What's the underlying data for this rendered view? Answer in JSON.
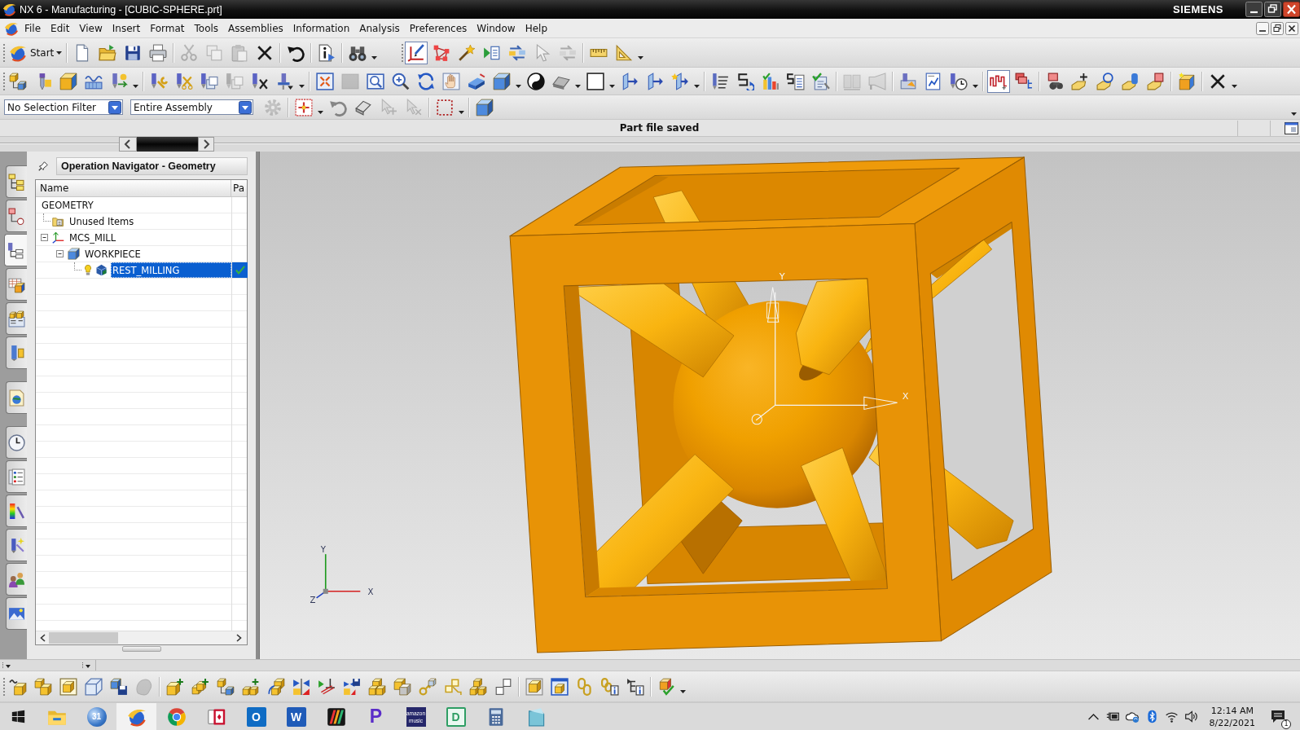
{
  "window": {
    "title": "NX 6 - Manufacturing - [CUBIC-SPHERE.prt]",
    "brand": "SIEMENS"
  },
  "menu": [
    {
      "label": "File"
    },
    {
      "label": "Edit"
    },
    {
      "label": "View"
    },
    {
      "label": "Insert"
    },
    {
      "label": "Format"
    },
    {
      "label": "Tools"
    },
    {
      "label": "Assemblies"
    },
    {
      "label": "Information"
    },
    {
      "label": "Analysis"
    },
    {
      "label": "Preferences"
    },
    {
      "label": "Window"
    },
    {
      "label": "Help"
    }
  ],
  "standard_toolbar": {
    "start_label": "Start",
    "buttons": [
      {
        "disabled": false,
        "on": false
      },
      {
        "disabled": false,
        "on": false
      },
      {
        "disabled": false,
        "on": false
      },
      {
        "disabled": false,
        "on": false
      },
      {
        "disabled": true,
        "on": false
      },
      {
        "disabled": true,
        "on": false
      },
      {
        "disabled": true,
        "on": false
      },
      {
        "disabled": false,
        "on": false
      },
      {
        "disabled": false,
        "on": false
      },
      {
        "disabled": false,
        "on": false
      },
      {
        "disabled": false,
        "on": false
      },
      {
        "disabled": false,
        "on": true
      },
      {
        "disabled": false,
        "on": false
      },
      {
        "disabled": false,
        "on": false
      },
      {
        "disabled": false,
        "on": false
      },
      {
        "disabled": false,
        "on": false
      },
      {
        "disabled": true,
        "on": false
      },
      {
        "disabled": true,
        "on": false
      },
      {
        "disabled": false,
        "on": false
      },
      {
        "disabled": false,
        "on": false
      }
    ]
  },
  "toolbar_row_2": {
    "buttons": [
      {
        "disabled": false,
        "on": false
      },
      {
        "disabled": false,
        "on": false
      },
      {
        "disabled": false,
        "on": false
      },
      {
        "disabled": false,
        "on": false
      },
      {
        "disabled": false,
        "on": false
      },
      {
        "disabled": false,
        "on": false
      },
      {
        "disabled": false,
        "on": false
      },
      {
        "disabled": false,
        "on": false
      },
      {
        "disabled": true,
        "on": false
      },
      {
        "disabled": false,
        "on": false
      },
      {
        "disabled": false,
        "on": false
      },
      {
        "disabled": false,
        "on": false
      },
      {
        "disabled": true,
        "on": false
      },
      {
        "disabled": false,
        "on": false
      },
      {
        "disabled": false,
        "on": false
      },
      {
        "disabled": false,
        "on": false
      },
      {
        "disabled": false,
        "on": false
      },
      {
        "disabled": false,
        "on": false
      },
      {
        "disabled": false,
        "on": false
      },
      {
        "disabled": false,
        "on": false
      },
      {
        "disabled": false,
        "on": false
      },
      {
        "disabled": false,
        "on": false
      },
      {
        "disabled": false,
        "on": false
      },
      {
        "disabled": false,
        "on": false
      },
      {
        "disabled": false,
        "on": false
      },
      {
        "disabled": false,
        "on": false
      },
      {
        "disabled": false,
        "on": false
      },
      {
        "disabled": false,
        "on": false
      },
      {
        "disabled": false,
        "on": false
      },
      {
        "disabled": false,
        "on": false
      },
      {
        "disabled": true,
        "on": false
      },
      {
        "disabled": true,
        "on": false
      },
      {
        "disabled": false,
        "on": false
      },
      {
        "disabled": false,
        "on": false
      },
      {
        "disabled": false,
        "on": false
      },
      {
        "disabled": false,
        "on": true
      },
      {
        "disabled": false,
        "on": false
      },
      {
        "disabled": false,
        "on": false
      },
      {
        "disabled": false,
        "on": false
      },
      {
        "disabled": false,
        "on": false
      },
      {
        "disabled": false,
        "on": false
      },
      {
        "disabled": false,
        "on": false
      },
      {
        "disabled": false,
        "on": false
      },
      {
        "disabled": false,
        "on": false
      }
    ]
  },
  "selection_bar": {
    "filter": "No Selection Filter",
    "scope": "Entire Assembly",
    "buttons": [
      {
        "disabled": true,
        "on": false
      },
      {
        "disabled": false,
        "on": false
      },
      {
        "disabled": true,
        "on": false
      },
      {
        "disabled": false,
        "on": false
      },
      {
        "disabled": true,
        "on": false
      },
      {
        "disabled": true,
        "on": false
      },
      {
        "disabled": false,
        "on": false
      },
      {
        "disabled": false,
        "on": false
      }
    ]
  },
  "status_bar": {
    "message": "Part file saved"
  },
  "resource_bar": {
    "groups": [
      {
        "tabs": [
          {
            "selected": false
          },
          {
            "selected": false
          },
          {
            "selected": true
          },
          {
            "selected": false
          },
          {
            "selected": false
          },
          {
            "selected": false
          }
        ]
      },
      {
        "tabs": [
          {
            "selected": false
          }
        ]
      },
      {
        "tabs": [
          {
            "selected": false
          },
          {
            "selected": false
          },
          {
            "selected": false
          },
          {
            "selected": false
          },
          {
            "selected": false
          },
          {
            "selected": false
          }
        ]
      }
    ]
  },
  "navigator": {
    "title": "Operation Navigator - Geometry",
    "columns": [
      "Name",
      "Pa"
    ],
    "tree": [
      {
        "name": "GEOMETRY",
        "kind": "root",
        "selected": false,
        "pa_tick": false,
        "children": [
          {
            "name": "Unused Items",
            "kind": "group",
            "selected": false,
            "pa_tick": false
          },
          {
            "name": "MCS_MILL",
            "kind": "mcs",
            "expanded": true,
            "selected": false,
            "pa_tick": false,
            "children": [
              {
                "name": "WORKPIECE",
                "kind": "workpiece",
                "expanded": true,
                "selected": false,
                "pa_tick": false,
                "children": [
                  {
                    "name": "REST_MILLING",
                    "kind": "operation",
                    "selected": true,
                    "pa_tick": true
                  }
                ]
              }
            ]
          }
        ]
      }
    ]
  },
  "graphics": {
    "wcs_axes": {
      "x_label": "X",
      "y_label": "Y",
      "z_label": "Z"
    },
    "mcs_axes": {
      "x_label": "X",
      "y_label": "Y"
    }
  },
  "bottom_toolbar": {
    "buttons": [
      {
        "disabled": false,
        "on": false
      },
      {
        "disabled": false,
        "on": false
      },
      {
        "disabled": false,
        "on": false
      },
      {
        "disabled": false,
        "on": false
      },
      {
        "disabled": false,
        "on": false
      },
      {
        "disabled": true,
        "on": false
      },
      {
        "disabled": false,
        "on": false
      },
      {
        "disabled": false,
        "on": false
      },
      {
        "disabled": false,
        "on": false
      },
      {
        "disabled": false,
        "on": false
      },
      {
        "disabled": false,
        "on": false
      },
      {
        "disabled": false,
        "on": false
      },
      {
        "disabled": false,
        "on": false
      },
      {
        "disabled": false,
        "on": false
      },
      {
        "disabled": false,
        "on": false
      },
      {
        "disabled": false,
        "on": false
      },
      {
        "disabled": false,
        "on": false
      },
      {
        "disabled": false,
        "on": false
      },
      {
        "disabled": false,
        "on": false
      },
      {
        "disabled": false,
        "on": false
      },
      {
        "disabled": false,
        "on": false
      },
      {
        "disabled": false,
        "on": false
      },
      {
        "disabled": false,
        "on": false
      },
      {
        "disabled": false,
        "on": false
      },
      {
        "disabled": false,
        "on": false
      },
      {
        "disabled": false,
        "on": false
      }
    ]
  },
  "taskbar": {
    "apps": [
      {
        "selected": false
      },
      {
        "selected": false,
        "glyph": "31"
      },
      {
        "selected": true
      },
      {
        "selected": false
      },
      {
        "selected": false
      },
      {
        "selected": false,
        "glyph": "O"
      },
      {
        "selected": false,
        "glyph": "W"
      },
      {
        "selected": false
      },
      {
        "selected": false,
        "glyph": "P"
      },
      {
        "selected": false,
        "glyph": "amazon music"
      },
      {
        "selected": false,
        "glyph": "D"
      },
      {
        "selected": false
      },
      {
        "selected": false
      }
    ],
    "clock": {
      "time": "12:14 AM",
      "date": "8/22/2021"
    },
    "notification_count": "1"
  }
}
